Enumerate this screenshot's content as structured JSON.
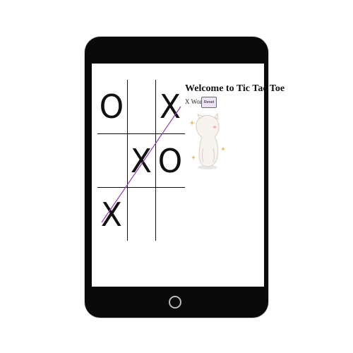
{
  "app": {
    "title": "Welcome to Tic Tac Toe",
    "status": "X Won",
    "reset_label": "Reset"
  },
  "board": {
    "cells": [
      "O",
      "",
      "X",
      "",
      "X",
      "O",
      "X",
      "",
      ""
    ],
    "winning_line": [
      2,
      4,
      6
    ],
    "win_line_color": "#8e3fb0"
  },
  "mascot": {
    "icon": "cartoon-cat-mascot",
    "color": "#f4f0ec",
    "accent_color": "#e9c46a"
  },
  "device": {
    "frame_color": "#0a0a0a",
    "screen_color": "#ffffff"
  }
}
